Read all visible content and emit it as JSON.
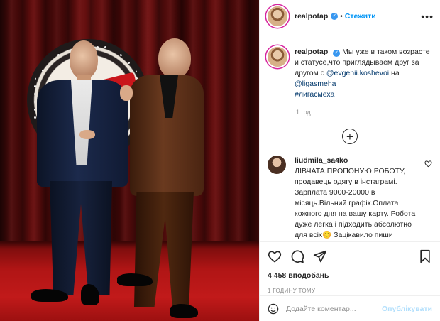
{
  "header": {
    "username": "realpotap",
    "separator": "•",
    "follow_label": "Стежити",
    "more_label": "•••"
  },
  "caption": {
    "username": "realpotap",
    "text_before": "Мы уже в таком возрасте и статусе,что приглядываем друг за другом с ",
    "mention_1": "@evgenii.koshevoi",
    "text_middle": " на ",
    "mention_2": "@ligasmeha",
    "hashtag": "#лигасмеха",
    "time_ago": "1 год"
  },
  "load_more_label": "+",
  "comments": [
    {
      "username": "liudmila_sa4ko",
      "text": "ДІВЧАТА.ПРОПОНУЮ РОБОТУ, продавець одягу в інстаграмі. Зарплата 9000-20000 в місяць.Вільний графік.Оплата кожного дня на вашу карту. Робота дуже легка і підходить абсолютно для всіх😊 Зацікавило пиши"
    }
  ],
  "actions": {
    "likes": "4 458 вподобань",
    "timestamp": "1 годину тому"
  },
  "add_comment": {
    "placeholder": "Додайте коментар...",
    "publish_label": "Опублікувати"
  },
  "colors": {
    "accent": "#0095f6",
    "verified": "#3897f0",
    "publish_disabled": "#b2dffc",
    "curtain": "#5a0c0c",
    "carpet": "#c11a1a"
  },
  "icons": [
    "verified-badge-icon",
    "more-options-icon",
    "add-circle-icon",
    "heart-icon",
    "comment-icon",
    "share-icon",
    "bookmark-icon",
    "emoji-icon"
  ]
}
